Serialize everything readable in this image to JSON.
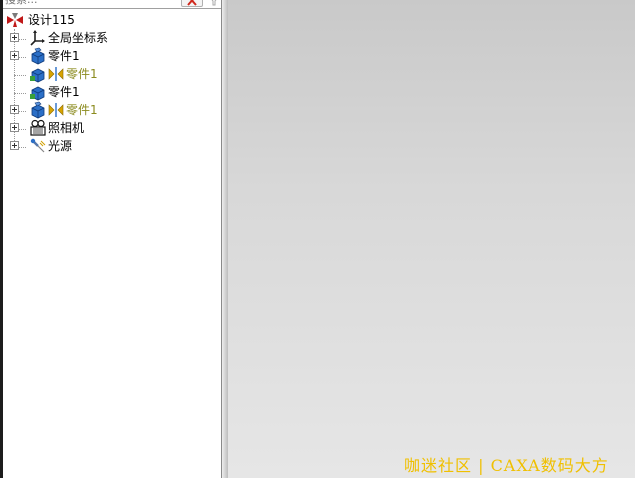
{
  "search": {
    "placeholder": "搜索..."
  },
  "tree": {
    "root_label": "设计115",
    "items": [
      {
        "label": "全局坐标系",
        "icon": "axes-icon"
      },
      {
        "label": "零件1",
        "icon": "part-icon"
      },
      {
        "label": "零件1",
        "icon": "mirror-part-icon",
        "style": "muted"
      },
      {
        "label": "零件1",
        "icon": "part-icon"
      },
      {
        "label": "零件1",
        "icon": "mirror-part-icon",
        "style": "muted"
      },
      {
        "label": "照相机",
        "icon": "camera-icon"
      },
      {
        "label": "光源",
        "icon": "light-icon"
      }
    ]
  },
  "watermark": {
    "text": "咖迷社区 | CAXA数码大方"
  },
  "colors": {
    "muted_label": "#8b8b1e",
    "watermark": "#f0c000",
    "part_blue": "#2b6fc7"
  }
}
